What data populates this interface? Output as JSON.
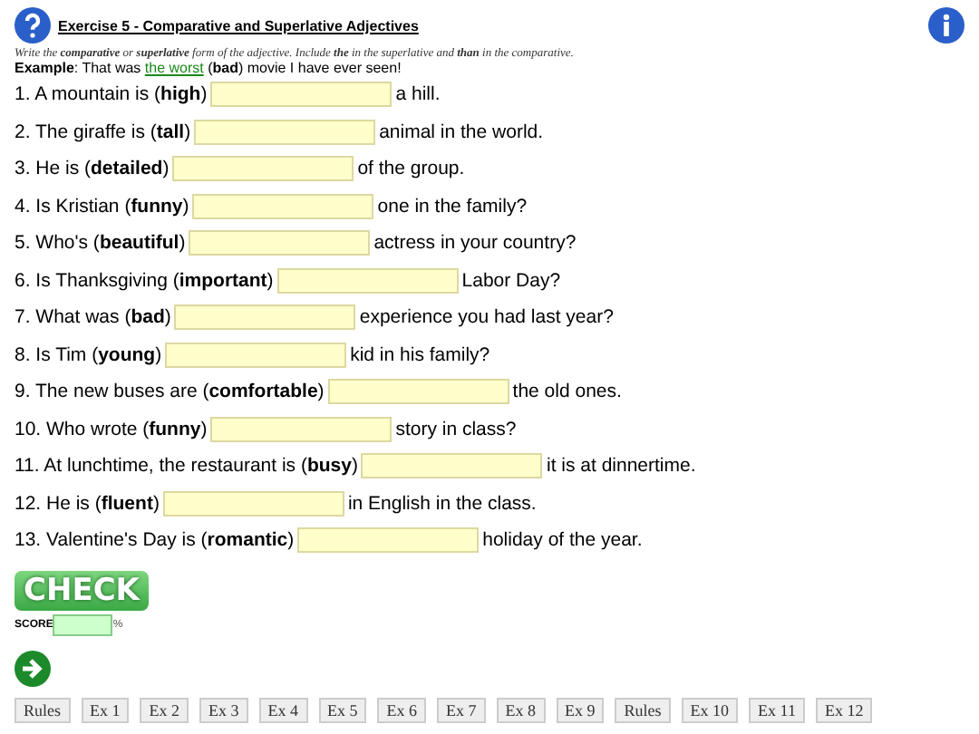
{
  "title": "Exercise 5 - Comparative and Superlative Adjectives",
  "instructions": "Write the **comparative** or **superlative** form of the adjective. Include **the** in the superlative and **than** in the comparative.",
  "example": {
    "label": "Example",
    "before": ": That was ",
    "answer": "the worst",
    "after": " (**bad**) movie I have ever seen!"
  },
  "questions": [
    {
      "prompt": "1. A mountain is (**high**)",
      "after": "a hill."
    },
    {
      "prompt": "2. The giraffe is (**tall**)",
      "after": "animal in the world."
    },
    {
      "prompt": "3. He is (**detailed**)",
      "after": "of the group."
    },
    {
      "prompt": "4. Is Kristian (**funny**)",
      "after": "one in the family?"
    },
    {
      "prompt": "5. Who's (**beautiful**)",
      "after": "actress in your country?"
    },
    {
      "prompt": "6. Is Thanksgiving (**important**)",
      "after": "Labor Day?"
    },
    {
      "prompt": "7. What was (**bad**)",
      "after": "experience you had last year?"
    },
    {
      "prompt": "8. Is Tim (**young**)",
      "after": "kid in his family?"
    },
    {
      "prompt": "9. The new buses are (**comfortable**)",
      "after": "the old ones."
    },
    {
      "prompt": "10. Who wrote (**funny**)",
      "after": "story in class?"
    },
    {
      "prompt": "11. At lunchtime, the restaurant is (**busy**)",
      "after": "it is at dinnertime."
    },
    {
      "prompt": "12. He is (**fluent**)",
      "after": "in English in the class."
    },
    {
      "prompt": "13. Valentine's Day is (**romantic**)",
      "after": "holiday of the year."
    }
  ],
  "check_button": "CHECK",
  "score": {
    "label": "SCORE",
    "unit": "%"
  },
  "nav": [
    "Rules",
    "Ex 1",
    "Ex 2",
    "Ex 3",
    "Ex 4",
    "Ex 5",
    "Ex 6",
    "Ex 7",
    "Ex 8",
    "Ex 9",
    "Rules",
    "Ex 10",
    "Ex 11",
    "Ex 12"
  ]
}
